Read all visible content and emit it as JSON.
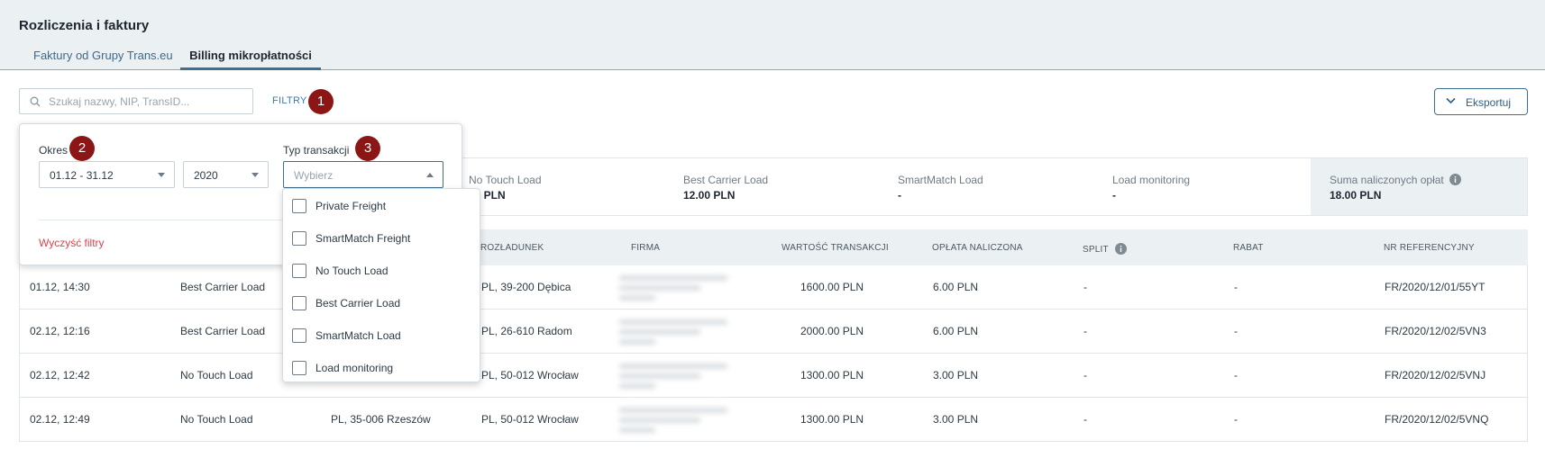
{
  "header": {
    "title": "Rozliczenia i faktury",
    "tabs": [
      {
        "label": "Faktury od Grupy Trans.eu",
        "active": false
      },
      {
        "label": "Billing mikropłatności",
        "active": true
      }
    ]
  },
  "toolbar": {
    "search_placeholder": "Szukaj nazwy, NIP, TransID...",
    "filters_label": "FILTRY",
    "export_label": "Eksportuj"
  },
  "badges": [
    "1",
    "2",
    "3"
  ],
  "filter_panel": {
    "period_label": "Okres",
    "period_value": "01.12 - 31.12",
    "year_value": "2020",
    "type_label": "Typ transakcji",
    "type_placeholder": "Wybierz",
    "clear_label": "Wyczyść filtry",
    "options": [
      "Private Freight",
      "SmartMatch Freight",
      "No Touch Load",
      "Best Carrier Load",
      "SmartMatch Load",
      "Load monitoring"
    ]
  },
  "summary": [
    {
      "name": "No Touch Load",
      "value": "00 PLN"
    },
    {
      "name": "Best Carrier Load",
      "value": "12.00 PLN"
    },
    {
      "name": "SmartMatch Load",
      "value": "-"
    },
    {
      "name": "Load monitoring",
      "value": "-"
    },
    {
      "name": "Suma naliczonych opłat",
      "value": "18.00 PLN"
    }
  ],
  "table": {
    "headers": [
      "ROZŁADUNEK",
      "FIRMA",
      "WARTOŚĆ TRANSAKCJI",
      "OPŁATA NALICZONA",
      "SPLIT",
      "RABAT",
      "NR REFERENCYJNY"
    ],
    "rows": [
      {
        "date": "01.12, 14:30",
        "type": "Best Carrier Load",
        "loading": "",
        "unloading": "PL, 39-200 Dębica",
        "value": "1600.00 PLN",
        "fee": "6.00 PLN",
        "split": "-",
        "discount": "-",
        "ref": "FR/2020/12/01/55YT"
      },
      {
        "date": "02.12, 12:16",
        "type": "Best Carrier Load",
        "loading": "",
        "unloading": "PL, 26-610 Radom",
        "value": "2000.00 PLN",
        "fee": "6.00 PLN",
        "split": "-",
        "discount": "-",
        "ref": "FR/2020/12/02/5VN3"
      },
      {
        "date": "02.12, 12:42",
        "type": "No Touch Load",
        "loading": "",
        "unloading": "PL, 50-012 Wrocław",
        "value": "1300.00 PLN",
        "fee": "3.00 PLN",
        "split": "-",
        "discount": "-",
        "ref": "FR/2020/12/02/5VNJ"
      },
      {
        "date": "02.12, 12:49",
        "type": "No Touch Load",
        "loading": "PL, 35-006 Rzeszów",
        "unloading": "PL, 50-012 Wrocław",
        "value": "1300.00 PLN",
        "fee": "3.00 PLN",
        "split": "-",
        "discount": "-",
        "ref": "FR/2020/12/02/5VNQ"
      }
    ]
  },
  "colors": {
    "accent": "#3d6f92",
    "badge": "#8c1515",
    "danger": "#d9434b",
    "header_bg": "#ebf0f3"
  }
}
